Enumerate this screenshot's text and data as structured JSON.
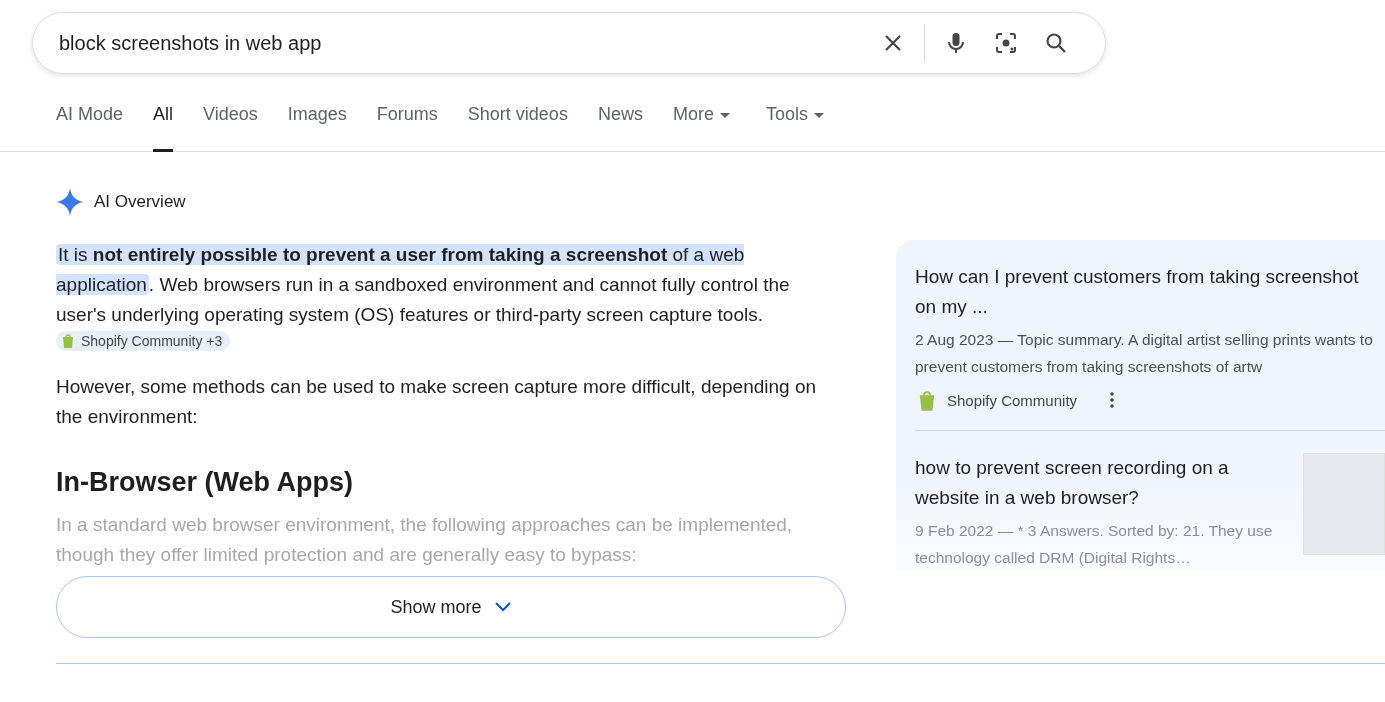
{
  "search": {
    "value": "block screenshots in web app"
  },
  "tabs": [
    {
      "label": "AI Mode",
      "selected": false,
      "dropdown": false
    },
    {
      "label": "All",
      "selected": true,
      "dropdown": false
    },
    {
      "label": "Videos",
      "selected": false,
      "dropdown": false
    },
    {
      "label": "Images",
      "selected": false,
      "dropdown": false
    },
    {
      "label": "Forums",
      "selected": false,
      "dropdown": false
    },
    {
      "label": "Short videos",
      "selected": false,
      "dropdown": false
    },
    {
      "label": "News",
      "selected": false,
      "dropdown": false
    },
    {
      "label": "More",
      "selected": false,
      "dropdown": true
    },
    {
      "label": "Tools",
      "selected": false,
      "dropdown": true
    }
  ],
  "overview": {
    "title": "AI Overview",
    "intro": {
      "highlight": "It is **not entirely possible to prevent a user from taking a screenshot** of a web application",
      "rest": ". Web browsers run in a sandboxed environment and cannot fully control the user's underlying operating system (OS) features or third-party screen capture tools.",
      "source_chip": "Shopify Community +3"
    },
    "paragraph": "However, some methods can be used to make screen capture more difficult, depending on the environment:",
    "heading": "In-Browser (Web Apps)",
    "faded_paragraph": "In a standard web browser environment, the following approaches can be implemented, though they offer limited protection and are generally easy to bypass:",
    "show_more": "Show more"
  },
  "sources": [
    {
      "title": "How can I prevent customers from taking screenshot on my ...",
      "snippet": "2 Aug 2023 — Topic summary. A digital artist selling prints wants to prevent customers from taking screenshots of artw",
      "site": "Shopify Community",
      "thumbnail": false,
      "faded": false
    },
    {
      "title": "how to prevent screen recording on a website in a web browser?",
      "snippet": "9 Feb 2022 — * 3 Answers. Sorted by: 21. They use technology called DRM (Digital Rights…",
      "thumbnail": true,
      "faded": true
    }
  ]
}
